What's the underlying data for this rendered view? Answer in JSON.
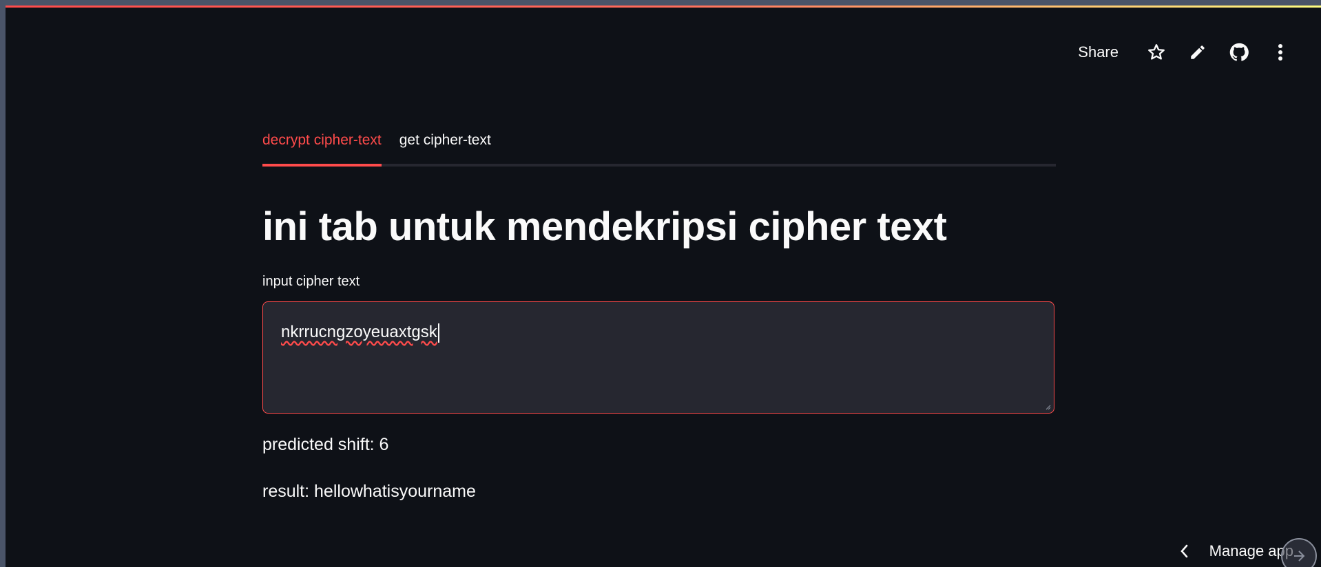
{
  "toolbar": {
    "share_label": "Share",
    "icons": [
      "star-icon",
      "pencil-icon",
      "github-icon",
      "kebab-menu-icon"
    ]
  },
  "tabs": [
    {
      "label": "decrypt cipher-text",
      "active": true
    },
    {
      "label": "get cipher-text",
      "active": false
    }
  ],
  "main": {
    "title": "ini tab untuk mendekripsi cipher text",
    "input_label": "input cipher text",
    "input_value": "nkrrucngzoyeuaxtgsk",
    "predicted_shift": "predicted shift: 6",
    "result": "result: hellowhatisyourname"
  },
  "footer": {
    "manage_label": "Manage app"
  },
  "colors": {
    "accent": "#ff4b4b",
    "background": "#0e1117",
    "input_bg": "#262730",
    "text": "#fafafa"
  }
}
